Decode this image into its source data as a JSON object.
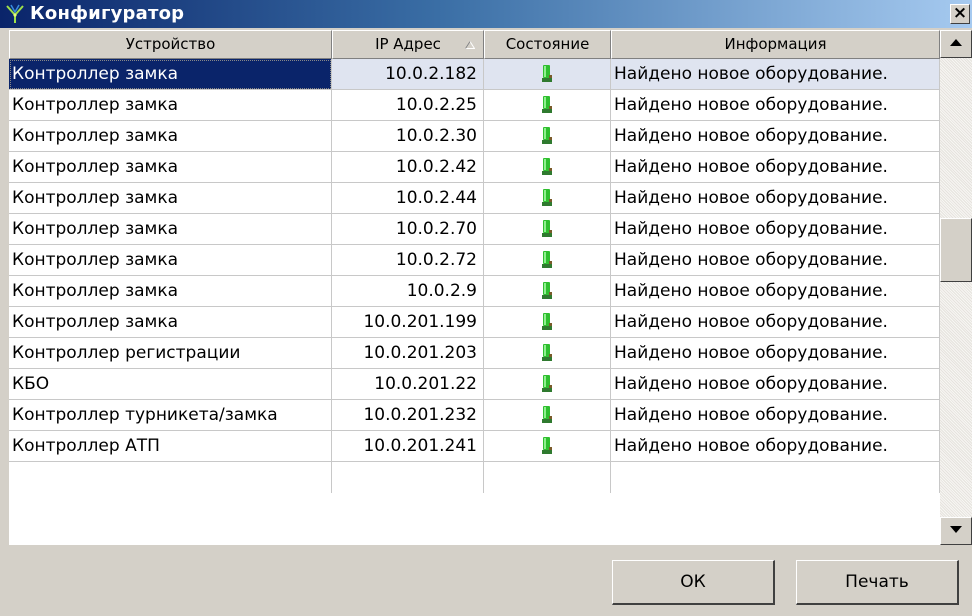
{
  "window": {
    "title": "Конфигуратор",
    "close_label": "×"
  },
  "columns": [
    {
      "label": "Устройство"
    },
    {
      "label": "IP Адрес"
    },
    {
      "label": "Состояние"
    },
    {
      "label": "Информация"
    }
  ],
  "rows": [
    {
      "device": "Контроллер замка",
      "ip": "10.0.2.182",
      "status_icon": "green-device-icon",
      "info": "Найдено новое оборудование.",
      "selected": true
    },
    {
      "device": "Контроллер замка",
      "ip": "10.0.2.25",
      "status_icon": "green-device-icon",
      "info": "Найдено новое оборудование."
    },
    {
      "device": "Контроллер замка",
      "ip": "10.0.2.30",
      "status_icon": "green-device-icon",
      "info": "Найдено новое оборудование."
    },
    {
      "device": "Контроллер замка",
      "ip": "10.0.2.42",
      "status_icon": "green-device-icon",
      "info": "Найдено новое оборудование."
    },
    {
      "device": "Контроллер замка",
      "ip": "10.0.2.44",
      "status_icon": "green-device-icon",
      "info": "Найдено новое оборудование."
    },
    {
      "device": "Контроллер замка",
      "ip": "10.0.2.70",
      "status_icon": "green-device-icon",
      "info": "Найдено новое оборудование."
    },
    {
      "device": "Контроллер замка",
      "ip": "10.0.2.72",
      "status_icon": "green-device-icon",
      "info": "Найдено новое оборудование."
    },
    {
      "device": "Контроллер замка",
      "ip": "10.0.2.9",
      "status_icon": "green-device-icon",
      "info": "Найдено новое оборудование."
    },
    {
      "device": "Контроллер замка",
      "ip": "10.0.201.199",
      "status_icon": "green-device-icon",
      "info": "Найдено новое оборудование."
    },
    {
      "device": "Контроллер регистрации",
      "ip": "10.0.201.203",
      "status_icon": "green-device-icon",
      "info": "Найдено новое оборудование."
    },
    {
      "device": "КБО",
      "ip": "10.0.201.22",
      "status_icon": "green-device-icon",
      "info": "Найдено новое оборудование."
    },
    {
      "device": "Контроллер турникета/замка",
      "ip": "10.0.201.232",
      "status_icon": "green-device-icon",
      "info": "Найдено новое оборудование."
    },
    {
      "device": "Контроллер АТП",
      "ip": "10.0.201.241",
      "status_icon": "green-device-icon",
      "info": "Найдено новое оборудование."
    }
  ],
  "buttons": {
    "ok": "ОК",
    "print": "Печать"
  },
  "colors": {
    "titlebar_start": "#0a246a",
    "titlebar_end": "#a6caf0",
    "selection": "#0a246a",
    "status_green": "#2fbf2f",
    "face": "#d4d0c8"
  }
}
